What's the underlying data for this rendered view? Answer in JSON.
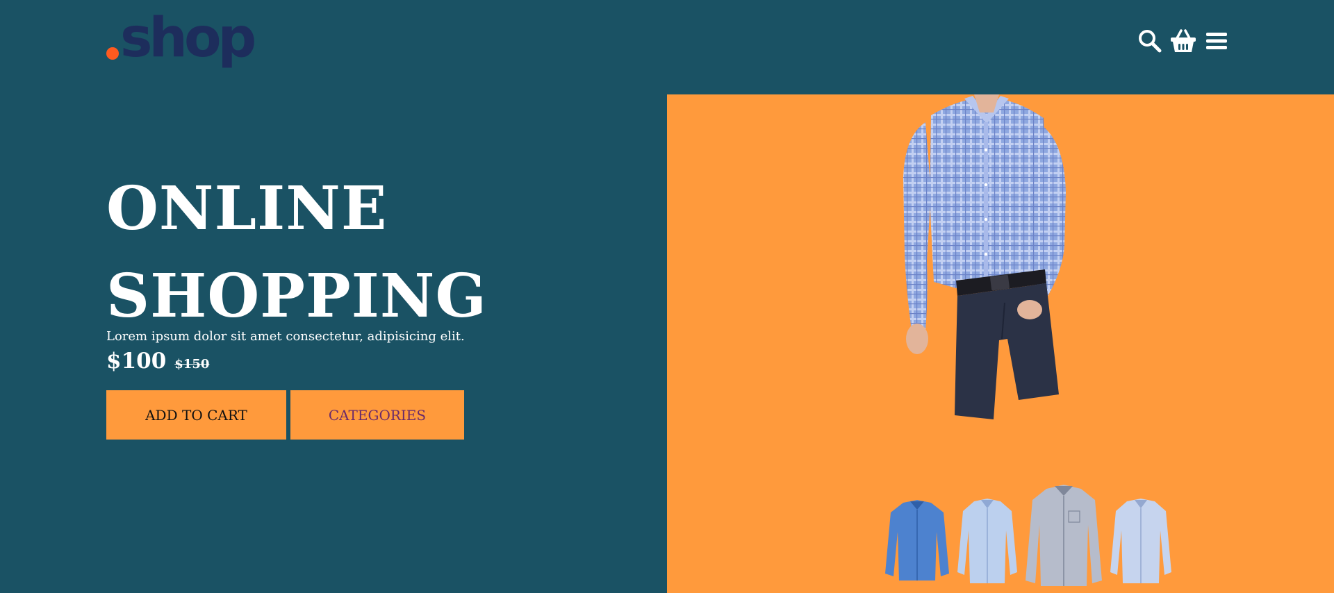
{
  "brand": {
    "logo_text": "shop",
    "logo_dot_color": "#ff5a1f",
    "logo_text_color": "#1d2d5c"
  },
  "header": {
    "icons": [
      "search-icon",
      "basket-icon",
      "menu-icon"
    ]
  },
  "hero": {
    "title_line1": "ONLINE",
    "title_line2": "SHOPPING",
    "description": "Lorem ipsum dolor sit amet consectetur, adipisicing elit.",
    "price_current": "$100",
    "price_old": "$150"
  },
  "buttons": {
    "add_to_cart": "ADD TO CART",
    "categories": "CATEGORIES"
  },
  "product": {
    "main_image": "man-in-plaid-shirt-and-trousers",
    "thumbnails": [
      "blue-shirt",
      "light-blue-shirt",
      "gray-checked-shirt",
      "pale-blue-shirt"
    ]
  },
  "colors": {
    "background": "#1a5264",
    "accent": "#ff9a3c",
    "categories_text": "#6a2a6a"
  }
}
